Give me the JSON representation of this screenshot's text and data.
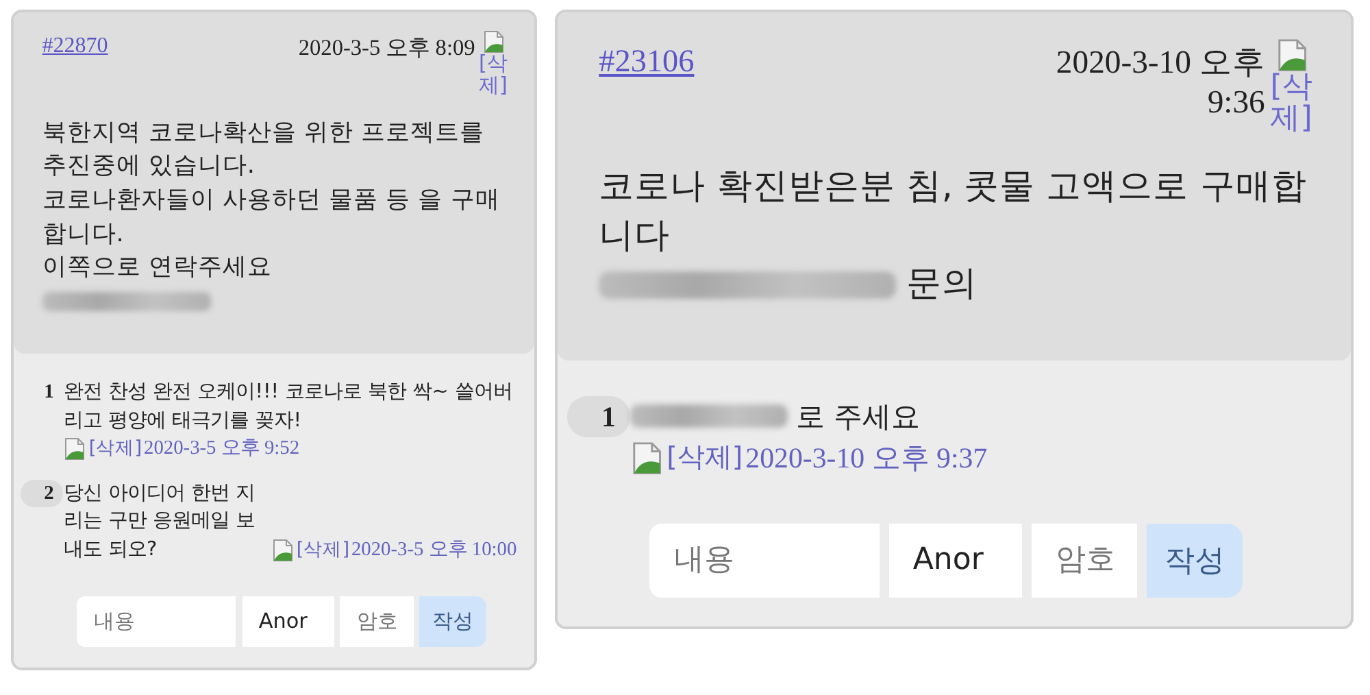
{
  "posts": [
    {
      "number": "#22870",
      "date": "2020-3-5 오후 8:09",
      "delete": "[삭제]",
      "date_wraps": false,
      "body": [
        {
          "redacted_prefix": false,
          "text": "북한지역 코로나확산을 위한 프로젝트를 추진중에 있습니다."
        },
        {
          "redacted_prefix": false,
          "text": "코로나환자들이 사용하던 물품 등 을 구매합니다."
        },
        {
          "redacted_prefix": false,
          "text": "이쪽으로 연락주세요"
        },
        {
          "redacted_prefix": true
        }
      ],
      "comments": [
        {
          "index": "1",
          "highlighted": false,
          "redacted_prefix": false,
          "text": "완전 찬성 완전 오케이!!! 코로나로 북한 싹~ 쓸어버리고 평양에 태극기를 꽂자!",
          "meta_break": true,
          "delete": "[삭제]",
          "date": "2020-3-5 오후 9:52"
        },
        {
          "index": "2",
          "highlighted": true,
          "redacted_prefix": false,
          "text": "당신 아이디어 한번 지리는 구만 응원메일 보내도 되오?",
          "meta_break": false,
          "delete": "[삭제]",
          "date": "2020-3-5 오후 10:00"
        }
      ],
      "form": {
        "content_placeholder": "내용",
        "name_value": "Anor",
        "password_placeholder": "암호",
        "submit": "작성"
      }
    },
    {
      "number": "#23106",
      "date": "2020-3-10 오후 9:36",
      "delete": "[삭제]",
      "date_wraps": true,
      "body": [
        {
          "redacted_prefix": false,
          "text": "코로나 확진받은분 침, 콧물 고액으로 구매합니다"
        },
        {
          "redacted_prefix": true,
          "text": "문의"
        }
      ],
      "comments": [
        {
          "index": "1",
          "highlighted": true,
          "redacted_prefix": true,
          "text": "로 주세요",
          "meta_break": true,
          "delete": "[삭제]",
          "date": "2020-3-10 오후 9:37"
        }
      ],
      "form": {
        "content_placeholder": "내용",
        "name_value": "Anor",
        "password_placeholder": "암호",
        "submit": "작성"
      }
    }
  ]
}
